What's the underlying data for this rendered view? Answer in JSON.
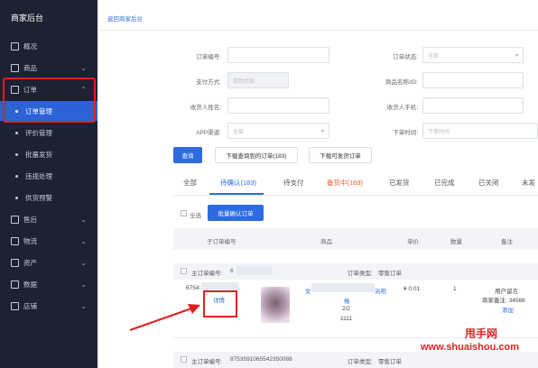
{
  "sidebar": {
    "title": "商家后台",
    "items": [
      {
        "label": "概况",
        "icon": "grid-icon"
      },
      {
        "label": "商品",
        "icon": "shop-icon"
      },
      {
        "label": "订单",
        "icon": "order-icon"
      },
      {
        "label": "售后",
        "icon": "after-sale-icon"
      },
      {
        "label": "物流",
        "icon": "truck-icon"
      },
      {
        "label": "资产",
        "icon": "wallet-icon"
      },
      {
        "label": "数据",
        "icon": "chart-icon"
      },
      {
        "label": "店铺",
        "icon": "store-icon"
      }
    ],
    "order_subitems": [
      "订单管理",
      "评价管理",
      "批量发货",
      "违规处理",
      "供货预警"
    ]
  },
  "back_link": "返回商家后台",
  "filters": {
    "order_no_label": "订单编号:",
    "order_status_label": "订单状态:",
    "order_status_value": "全部",
    "pay_method_label": "支付方式:",
    "pay_method_value": "货到付款",
    "product_name_label": "商品名称/ID:",
    "receiver_name_label": "收货人姓名:",
    "receiver_phone_label": "收货人手机:",
    "app_channel_label": "APP渠道:",
    "app_channel_value": "全部",
    "order_time_label": "下单时间:",
    "order_time_placeholder": "下单时间"
  },
  "actions": {
    "search": "查询",
    "download_query": "下载查询到的订单(183)",
    "download_shippable": "下载可发货订单"
  },
  "tabs": [
    {
      "label": "全部"
    },
    {
      "label": "待确认(183)"
    },
    {
      "label": "待支付"
    },
    {
      "label": "备货中(169)",
      "highlight": true
    },
    {
      "label": "已发货"
    },
    {
      "label": "已完成"
    },
    {
      "label": "已关闭"
    },
    {
      "label": "未发"
    }
  ],
  "bulk": {
    "select_all": "全选",
    "confirm_button": "批量确认订单"
  },
  "table_headers": [
    "子订单编号",
    "商品",
    "单价",
    "数量",
    "备注"
  ],
  "order1": {
    "head_label": "主订单编号:",
    "head_value": "6",
    "type_label": "订单类型:",
    "type_value": "零售订单",
    "sub_order_prefix": "6754:",
    "detail_link": "详情",
    "product_prefix": "女",
    "product_suffix": "浴袍",
    "spec1": "格",
    "spec2": "2/2",
    "spec3": "1111",
    "price": "¥ 0.01",
    "qty": "1",
    "remark_user": "用户留言:",
    "remark_merchant": "商家备注: 34566",
    "remark_add": "添加"
  },
  "order2": {
    "head_label": "主订单编号:",
    "head_value": "8753591065542350088",
    "type_label": "订单类型:",
    "type_value": "零售订单"
  },
  "watermark": {
    "line1": "甩手网",
    "line2": "www.shuaishou.com"
  },
  "colors": {
    "sidebar_bg": "#1d2233",
    "accent": "#2d6cdf",
    "tab_orange": "#e8602c",
    "annotation_red": "#e02020"
  }
}
